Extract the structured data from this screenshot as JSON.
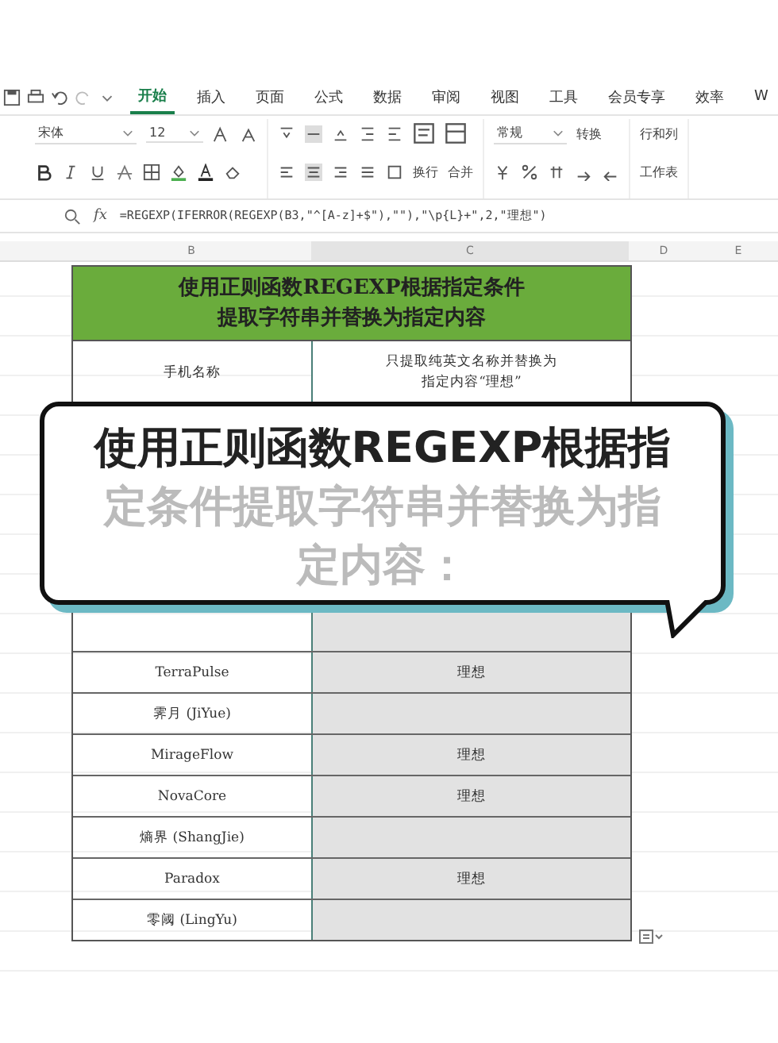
{
  "tabs": [
    {
      "label": "开始",
      "selected": true
    },
    {
      "label": "插入",
      "selected": false
    },
    {
      "label": "页面",
      "selected": false
    },
    {
      "label": "公式",
      "selected": false
    },
    {
      "label": "数据",
      "selected": false
    },
    {
      "label": "审阅",
      "selected": false
    },
    {
      "label": "视图",
      "selected": false
    },
    {
      "label": "工具",
      "selected": false
    },
    {
      "label": "会员专享",
      "selected": false
    },
    {
      "label": "效率",
      "selected": false
    },
    {
      "label": "W",
      "selected": false
    }
  ],
  "ribbon": {
    "font_name": "宋体",
    "font_size": "12",
    "wrap_label": "换行",
    "merge_label": "合并",
    "number_format": "常规",
    "convert_label": "转换",
    "rows_cols_label": "行和列",
    "sheet_label": "工作表"
  },
  "formula_bar": {
    "fx_label": "fx",
    "formula": "=REGEXP(IFERROR(REGEXP(B3,\"^[A-z]+$\"),\"\"),\"\\p{L}+\",2,\"理想\")"
  },
  "columns": [
    "B",
    "C",
    "D",
    "E"
  ],
  "table": {
    "title_lines": [
      "使用正则函数REGEXP根据指定条件",
      "提取字符串并替换为指定内容"
    ],
    "header_name": "手机名称",
    "header_result_lines": [
      "只提取纯英文名称并替换为",
      "指定内容“理想”"
    ],
    "rows": [
      {
        "name": "TerraPulse",
        "result": "理想"
      },
      {
        "name": "霁月 (JiYue)",
        "result": ""
      },
      {
        "name": "MirageFlow",
        "result": "理想"
      },
      {
        "name": "NovaCore",
        "result": "理想"
      },
      {
        "name": "熵界 (ShangJie)",
        "result": ""
      },
      {
        "name": "Paradox",
        "result": "理想"
      },
      {
        "name": "零阈 (LingYu)",
        "result": ""
      }
    ]
  },
  "bubble": {
    "lines": [
      "使用正则函数REGEXP根据指",
      "定条件提取字符串并替换为指",
      "定内容："
    ]
  }
}
